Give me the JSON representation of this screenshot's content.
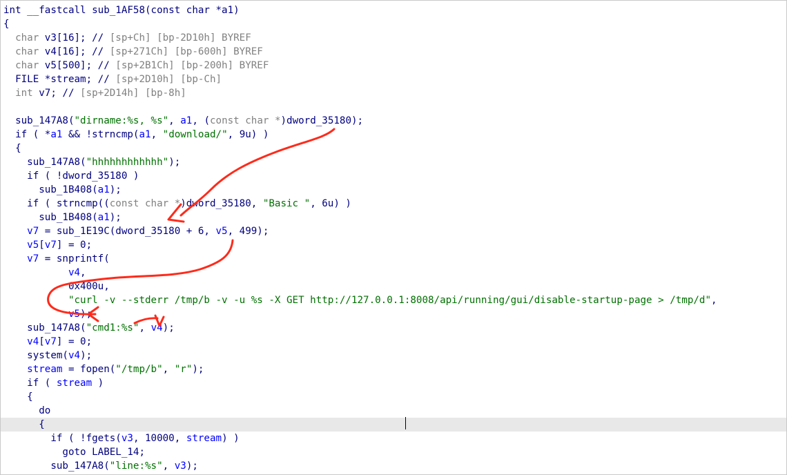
{
  "editor": {
    "current_line_index": 30,
    "lines": [
      [
        [
          "k",
          "int __fastcall sub_1AF58(const char *a1)"
        ]
      ],
      [
        [
          "k",
          "{"
        ]
      ],
      [
        [
          "g",
          "  char "
        ],
        [
          "k",
          "v3[16]; // "
        ],
        [
          "g",
          "[sp+Ch] [bp-2D10h] BYREF"
        ]
      ],
      [
        [
          "g",
          "  char "
        ],
        [
          "k",
          "v4[16]; // "
        ],
        [
          "g",
          "[sp+271Ch] [bp-600h] BYREF"
        ]
      ],
      [
        [
          "g",
          "  char "
        ],
        [
          "k",
          "v5[500]; // "
        ],
        [
          "g",
          "[sp+2B1Ch] [bp-200h] BYREF"
        ]
      ],
      [
        [
          "k",
          "  FILE *stream; // "
        ],
        [
          "g",
          "[sp+2D10h] [bp-Ch]"
        ]
      ],
      [
        [
          "g",
          "  int "
        ],
        [
          "k",
          "v7; // "
        ],
        [
          "g",
          "[sp+2D14h] [bp-8h]"
        ]
      ],
      [
        [
          "k",
          ""
        ]
      ],
      [
        [
          "k",
          "  sub_147A8("
        ],
        [
          "s",
          "\"dirname:%s, %s\""
        ],
        [
          "k",
          ", "
        ],
        [
          "v",
          "a1"
        ],
        [
          "k",
          ", ("
        ],
        [
          "g",
          "const char *"
        ],
        [
          "k",
          ")dword_35180);"
        ]
      ],
      [
        [
          "k",
          "  if ( *"
        ],
        [
          "v",
          "a1"
        ],
        [
          "k",
          " && !strncmp("
        ],
        [
          "v",
          "a1"
        ],
        [
          "k",
          ", "
        ],
        [
          "s",
          "\"download/\""
        ],
        [
          "k",
          ", 9u) )"
        ]
      ],
      [
        [
          "k",
          "  {"
        ]
      ],
      [
        [
          "k",
          "    sub_147A8("
        ],
        [
          "s",
          "\"hhhhhhhhhhhh\""
        ],
        [
          "k",
          ");"
        ]
      ],
      [
        [
          "k",
          "    if ( !dword_35180 )"
        ]
      ],
      [
        [
          "k",
          "      sub_1B408("
        ],
        [
          "v",
          "a1"
        ],
        [
          "k",
          ");"
        ]
      ],
      [
        [
          "k",
          "    if ( strncmp(("
        ],
        [
          "g",
          "const char *"
        ],
        [
          "k",
          ")dword_35180, "
        ],
        [
          "s",
          "\"Basic \""
        ],
        [
          "k",
          ", 6u) )"
        ]
      ],
      [
        [
          "k",
          "      sub_1B408("
        ],
        [
          "v",
          "a1"
        ],
        [
          "k",
          ");"
        ]
      ],
      [
        [
          "v",
          "    v7"
        ],
        [
          "k",
          " = sub_1E19C(dword_35180 + 6, "
        ],
        [
          "v",
          "v5"
        ],
        [
          "k",
          ", 499);"
        ]
      ],
      [
        [
          "v",
          "    v5"
        ],
        [
          "k",
          "["
        ],
        [
          "v",
          "v7"
        ],
        [
          "k",
          "] = 0;"
        ]
      ],
      [
        [
          "v",
          "    v7"
        ],
        [
          "k",
          " = snprintf("
        ]
      ],
      [
        [
          "v",
          "           v4"
        ],
        [
          "k",
          ","
        ]
      ],
      [
        [
          "k",
          "           0x400u,"
        ]
      ],
      [
        [
          "s",
          "           \"curl -v --stderr /tmp/b -v -u %s -X GET http://127.0.0.1:8008/api/running/gui/disable-startup-page > /tmp/d\""
        ],
        [
          "k",
          ","
        ]
      ],
      [
        [
          "v",
          "           v5"
        ],
        [
          "k",
          ");"
        ]
      ],
      [
        [
          "k",
          "    sub_147A8("
        ],
        [
          "s",
          "\"cmd1:%s\""
        ],
        [
          "k",
          ", "
        ],
        [
          "v",
          "v4"
        ],
        [
          "k",
          ");"
        ]
      ],
      [
        [
          "v",
          "    v4"
        ],
        [
          "k",
          "["
        ],
        [
          "v",
          "v7"
        ],
        [
          "k",
          "] = 0;"
        ]
      ],
      [
        [
          "k",
          "    system("
        ],
        [
          "v",
          "v4"
        ],
        [
          "k",
          ");"
        ]
      ],
      [
        [
          "v",
          "    stream"
        ],
        [
          "k",
          " = fopen("
        ],
        [
          "s",
          "\"/tmp/b\""
        ],
        [
          "k",
          ", "
        ],
        [
          "s",
          "\"r\""
        ],
        [
          "k",
          ");"
        ]
      ],
      [
        [
          "k",
          "    if ( "
        ],
        [
          "v",
          "stream"
        ],
        [
          "k",
          " )"
        ]
      ],
      [
        [
          "k",
          "    {"
        ]
      ],
      [
        [
          "k",
          "      do"
        ]
      ],
      [
        [
          "k",
          "      {"
        ]
      ],
      [
        [
          "k",
          "        if ( !fgets("
        ],
        [
          "v",
          "v3"
        ],
        [
          "k",
          ", 10000, "
        ],
        [
          "v",
          "stream"
        ],
        [
          "k",
          ") )"
        ]
      ],
      [
        [
          "k",
          "          goto LABEL_14;"
        ]
      ],
      [
        [
          "k",
          "        sub_147A8("
        ],
        [
          "s",
          "\"line:%s\""
        ],
        [
          "k",
          ", "
        ],
        [
          "v",
          "v3"
        ],
        [
          "k",
          ");"
        ]
      ]
    ]
  },
  "annotations": {
    "color": "#ff2a1a"
  }
}
